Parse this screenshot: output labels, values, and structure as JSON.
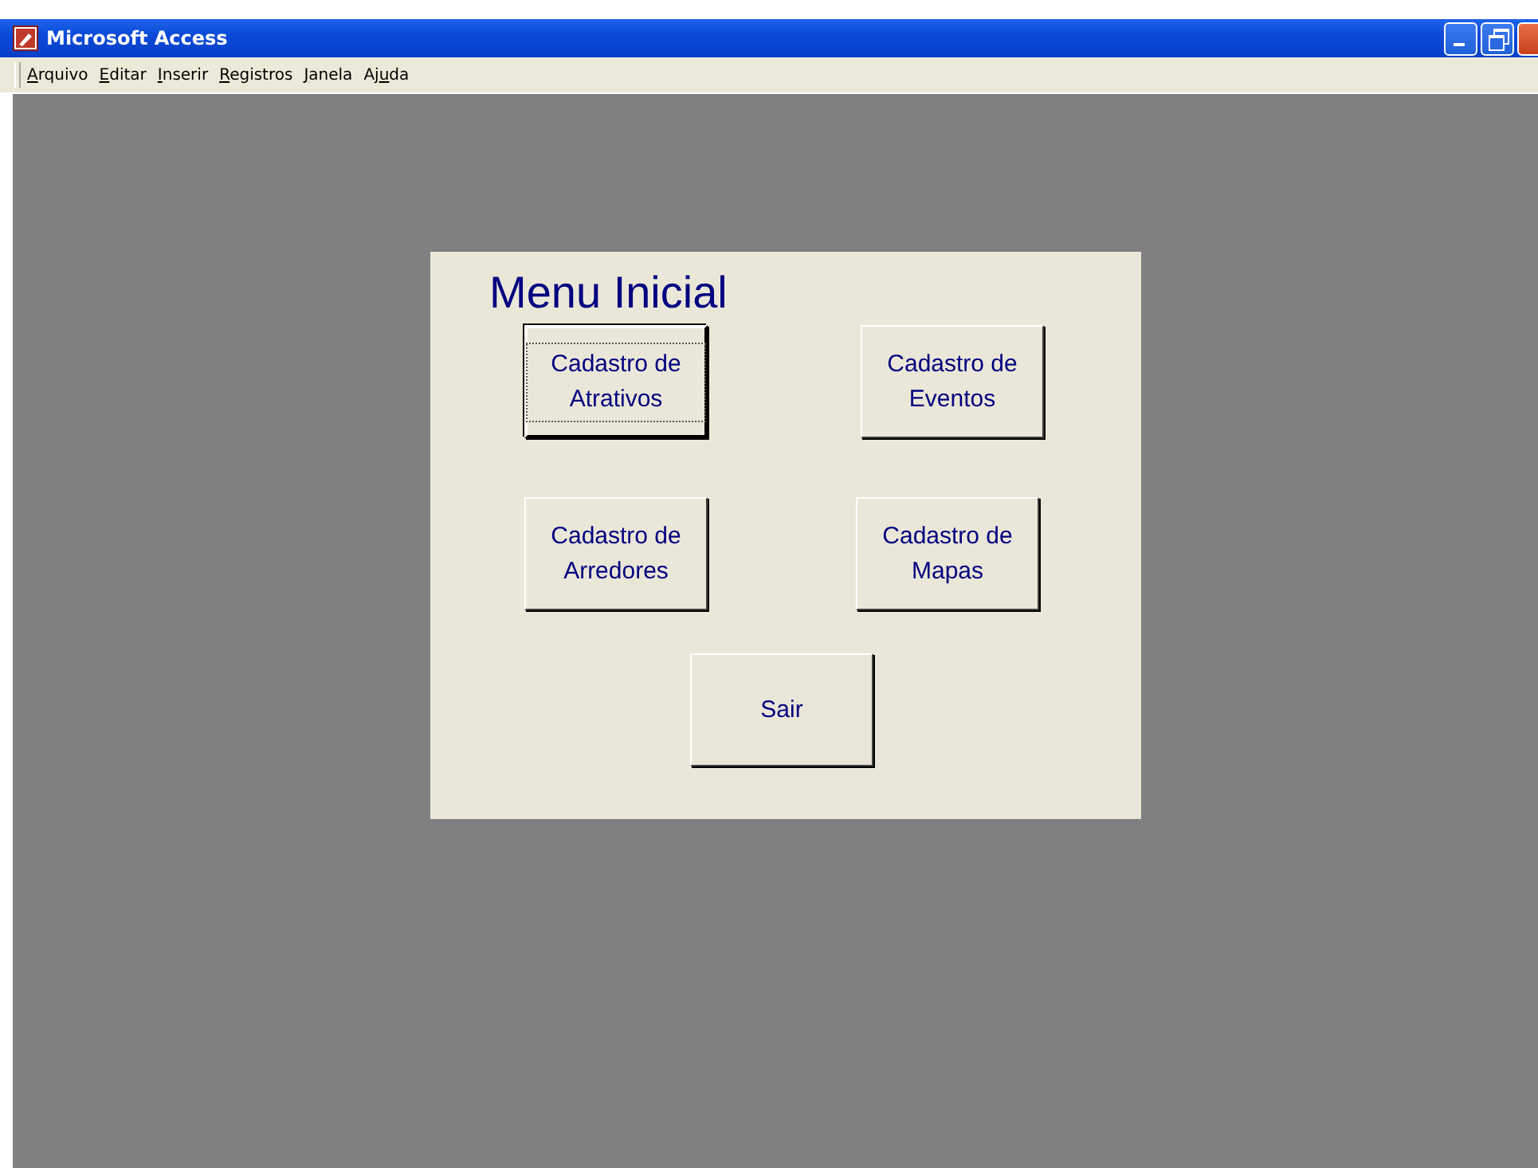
{
  "window": {
    "title": "Microsoft Access"
  },
  "menu": [
    {
      "key": "A",
      "after": "rquivo"
    },
    {
      "key": "E",
      "after": "ditar"
    },
    {
      "key": "I",
      "after": "nserir"
    },
    {
      "key": "R",
      "after": "egistros"
    },
    {
      "key": "J",
      "after": "anela"
    },
    {
      "before": "Aj",
      "key": "u",
      "after": "da"
    }
  ],
  "form": {
    "title": "Menu Inicial",
    "rows": [
      [
        {
          "label": "Cadastro de Atrativos",
          "focused": true
        },
        {
          "label": "Cadastro de Eventos",
          "focused": false
        }
      ],
      [
        {
          "label": "Cadastro de Arredores",
          "focused": false
        },
        {
          "label": "Cadastro de Mapas",
          "focused": false
        }
      ],
      [
        {
          "label": "Sair",
          "focused": false
        }
      ]
    ]
  }
}
